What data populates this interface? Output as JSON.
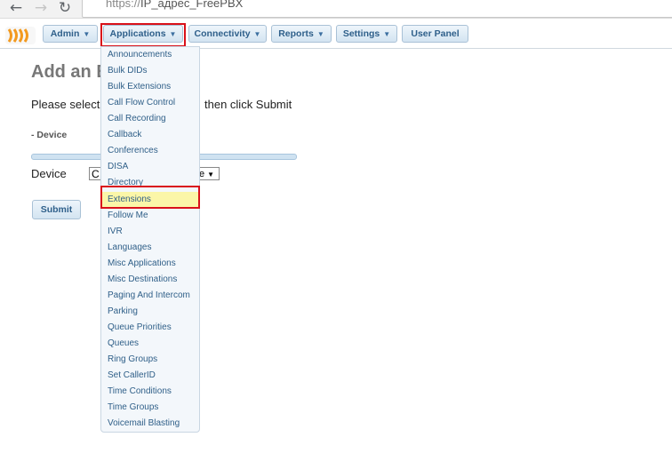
{
  "browser": {
    "back_icon": "arrow-left-icon",
    "forward_icon": "arrow-right-icon",
    "reload_icon": "reload-icon",
    "url_scheme": "https://",
    "url_rest": "IP_адрес_FreePBX"
  },
  "topnav": {
    "items": [
      {
        "label": "Admin"
      },
      {
        "label": "Applications"
      },
      {
        "label": "Connectivity"
      },
      {
        "label": "Reports"
      },
      {
        "label": "Settings"
      },
      {
        "label": "User Panel"
      }
    ],
    "highlighted": "Applications"
  },
  "main": {
    "title": "Add an E",
    "instruction_left": "Please select",
    "instruction_right": "then click Submit",
    "section_label": "- Device",
    "device_label": "Device",
    "device_select_start": "C",
    "device_select_end": "e",
    "submit_label": "Submit"
  },
  "applications_menu": {
    "items": [
      "Announcements",
      "Bulk DIDs",
      "Bulk Extensions",
      "Call Flow Control",
      "Call Recording",
      "Callback",
      "Conferences",
      "DISA",
      "Directory",
      "Extensions",
      "Follow Me",
      "IVR",
      "Languages",
      "Misc Applications",
      "Misc Destinations",
      "Paging And Intercom",
      "Parking",
      "Queue Priorities",
      "Queues",
      "Ring Groups",
      "Set CallerID",
      "Time Conditions",
      "Time Groups",
      "Voicemail Blasting"
    ],
    "selected": "Extensions"
  },
  "colors": {
    "highlight_frame": "#d9111a",
    "menu_text": "#2e5f8a",
    "selected_bg": "#fbf6a8"
  }
}
